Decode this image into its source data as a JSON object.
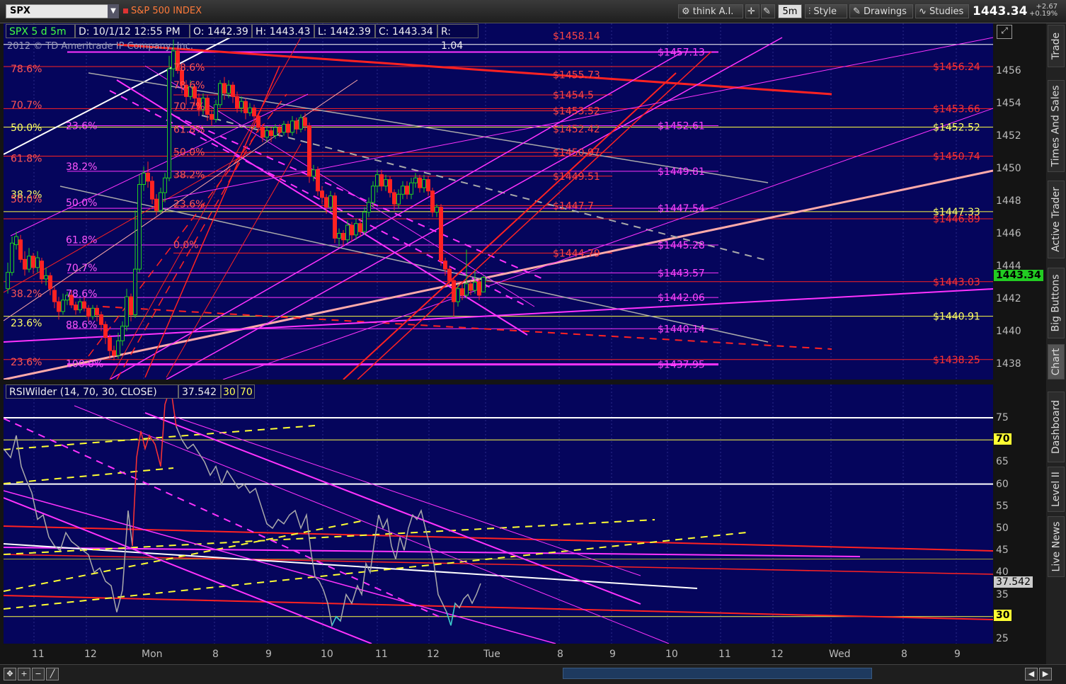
{
  "toolbar": {
    "symbol": "SPX",
    "index_name": "S&P 500 INDEX",
    "think_ai": "think A.I.",
    "interval": "5m",
    "style": "Style",
    "drawings": "Drawings",
    "studies": "Studies",
    "last_price": "1443.34",
    "change_abs": "+2.67",
    "change_pct": "+0.19%"
  },
  "chart_header": {
    "symbol_period": "SPX 5 d 5m",
    "date": "D: 10/1/12 12:55 PM",
    "open": "O: 1442.39",
    "high": "H: 1443.43",
    "low": "L: 1442.39",
    "close": "C: 1443.34",
    "range": "R: 1.04"
  },
  "copyright": "2012 © TD Ameritrade IP Company, Inc.",
  "rsi_header": {
    "study": "RSIWilder (14, 70, 30, CLOSE)",
    "value": "37.542",
    "oversold": "30",
    "overbought": "70"
  },
  "price_axis": {
    "ticks": [
      "1456",
      "1454",
      "1452",
      "1450",
      "1448",
      "1446",
      "1444",
      "1442",
      "1440",
      "1438"
    ],
    "current_tag": "1443.34"
  },
  "rsi_axis": {
    "ticks": [
      "75",
      "70",
      "65",
      "60",
      "55",
      "50",
      "45",
      "40",
      "35",
      "30",
      "25"
    ],
    "current_tag": "37.542",
    "tag_70": "70",
    "tag_30": "30"
  },
  "time_axis": {
    "ticks": [
      "11",
      "12",
      "Mon",
      "8",
      "9",
      "10",
      "11",
      "12",
      "Tue",
      "8",
      "9",
      "10",
      "11",
      "12",
      "Wed",
      "8",
      "9"
    ]
  },
  "fib_left": [
    {
      "text": "78.6%",
      "color": "#ff5555"
    },
    {
      "text": "70.7%",
      "color": "#ff5555"
    },
    {
      "text": "50.0%",
      "color": "#ffff66"
    },
    {
      "text": "61.8%",
      "color": "#ff5555"
    },
    {
      "text": "38.2%",
      "color": "#ffff66"
    },
    {
      "text": "50.0%",
      "color": "#ff5555"
    },
    {
      "text": "38.2%",
      "color": "#ff5555"
    },
    {
      "text": "23.6%",
      "color": "#ffff66"
    },
    {
      "text": "23.6%",
      "color": "#ff5555"
    }
  ],
  "fib_mid": [
    {
      "text": "23.6%",
      "color": "#ff55ff"
    },
    {
      "text": "38.2%",
      "color": "#ff55ff"
    },
    {
      "text": "50.0%",
      "color": "#ff55ff"
    },
    {
      "text": "61.8%",
      "color": "#ff55ff"
    },
    {
      "text": "70.7%",
      "color": "#ff55ff"
    },
    {
      "text": "78.6%",
      "color": "#ff55ff"
    },
    {
      "text": "88.6%",
      "color": "#ff55ff"
    },
    {
      "text": "100.0%",
      "color": "#ff55ff"
    }
  ],
  "fib_inner": [
    {
      "text": "78.6%",
      "color": "#ff5555"
    },
    {
      "text": "78.6%",
      "color": "#ff5555"
    },
    {
      "text": "70.7%",
      "color": "#ff5555"
    },
    {
      "text": "61.8%",
      "color": "#ff5555"
    },
    {
      "text": "50.0%",
      "color": "#ff5555"
    },
    {
      "text": "38.2%",
      "color": "#ff5555"
    },
    {
      "text": "23.6%",
      "color": "#ff5555"
    },
    {
      "text": "0.0%",
      "color": "#ff5555"
    }
  ],
  "levels_red_mid": [
    "$1458.14",
    "$1455.73",
    "$1454.5",
    "$1453.52",
    "$1452.42",
    "$1450.97",
    "$1449.51",
    "$1447.7",
    "$1444.79"
  ],
  "levels_magenta": [
    "$1457.13",
    "$1452.61",
    "$1449.81",
    "$1447.54",
    "$1445.28",
    "$1443.57",
    "$1442.06",
    "$1440.14",
    "$1437.95"
  ],
  "levels_right": [
    {
      "text": "$1456.24",
      "color": "#ff3333"
    },
    {
      "text": "$1453.66",
      "color": "#ff3333"
    },
    {
      "text": "$1452.52",
      "color": "#ffff66"
    },
    {
      "text": "$1450.74",
      "color": "#ff3333"
    },
    {
      "text": "$1447.33",
      "color": "#ffff66"
    },
    {
      "text": "$1446.89",
      "color": "#ff3333"
    },
    {
      "text": "$1443.03",
      "color": "#ff3333"
    },
    {
      "text": "$1440.91",
      "color": "#ffff66"
    },
    {
      "text": "$1438.25",
      "color": "#ff3333"
    }
  ],
  "sidebar": [
    "Trade",
    "Times And Sales",
    "Active Trader",
    "Big Buttons",
    "Chart",
    "Dashboard",
    "Level II",
    "Live News"
  ],
  "colors": {
    "panel": "#05055c",
    "up": "#22cc22",
    "down": "#ff2222",
    "fib_red": "#ff2222",
    "fib_magenta": "#ff33ff",
    "yellow": "#ffff33"
  }
}
